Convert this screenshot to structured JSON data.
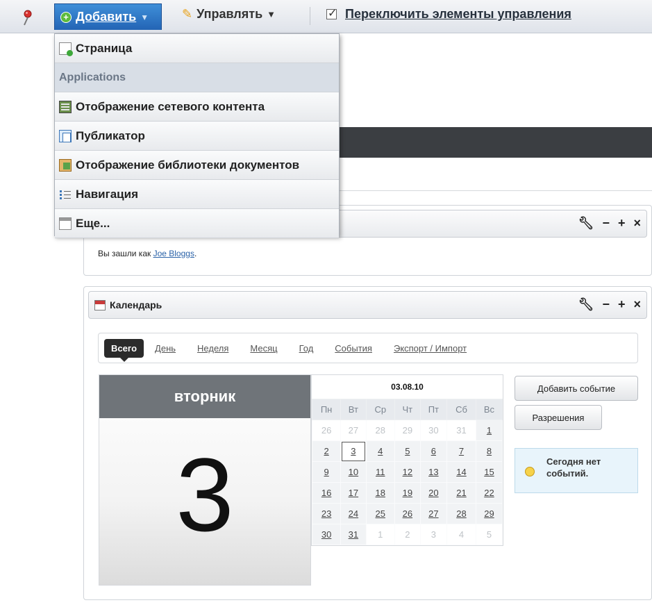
{
  "dockbar": {
    "add_label": "Добавить",
    "manage_label": "Управлять",
    "toggle_label": "Переключить элементы управления"
  },
  "menu": {
    "items": [
      {
        "label": "Страница",
        "icon": "page-add-icon"
      },
      {
        "label": "Applications",
        "section": true
      },
      {
        "label": "Отображение сетевого контента",
        "icon": "web-content-icon"
      },
      {
        "label": "Публикатор",
        "icon": "publisher-icon"
      },
      {
        "label": "Отображение библиотеки документов",
        "icon": "document-library-icon"
      },
      {
        "label": "Навигация",
        "icon": "navigation-icon"
      },
      {
        "label": "Еще...",
        "icon": "more-icon"
      }
    ]
  },
  "login_portlet": {
    "text_prefix": "Вы зашли как ",
    "user_link": "Joe Bloggs",
    "text_suffix": "."
  },
  "calendar": {
    "title": "Календарь",
    "tabs": [
      "Всего",
      "День",
      "Неделя",
      "Месяц",
      "Год",
      "События",
      "Экспорт / Импорт"
    ],
    "day_name": "вторник",
    "day_number": "3",
    "month_header": "03.08.10",
    "weekdays": [
      "Пн",
      "Вт",
      "Ср",
      "Чт",
      "Пт",
      "Сб",
      "Вс"
    ],
    "weeks": [
      [
        "26",
        "27",
        "28",
        "29",
        "30",
        "31",
        "1"
      ],
      [
        "2",
        "3",
        "4",
        "5",
        "6",
        "7",
        "8"
      ],
      [
        "9",
        "10",
        "11",
        "12",
        "13",
        "14",
        "15"
      ],
      [
        "16",
        "17",
        "18",
        "19",
        "20",
        "21",
        "22"
      ],
      [
        "23",
        "24",
        "25",
        "26",
        "27",
        "28",
        "29"
      ],
      [
        "30",
        "31",
        "1",
        "2",
        "3",
        "4",
        "5"
      ]
    ],
    "add_event_button": "Добавить событие",
    "permissions_button": "Разрешения",
    "no_events": "Сегодня нет событий."
  }
}
